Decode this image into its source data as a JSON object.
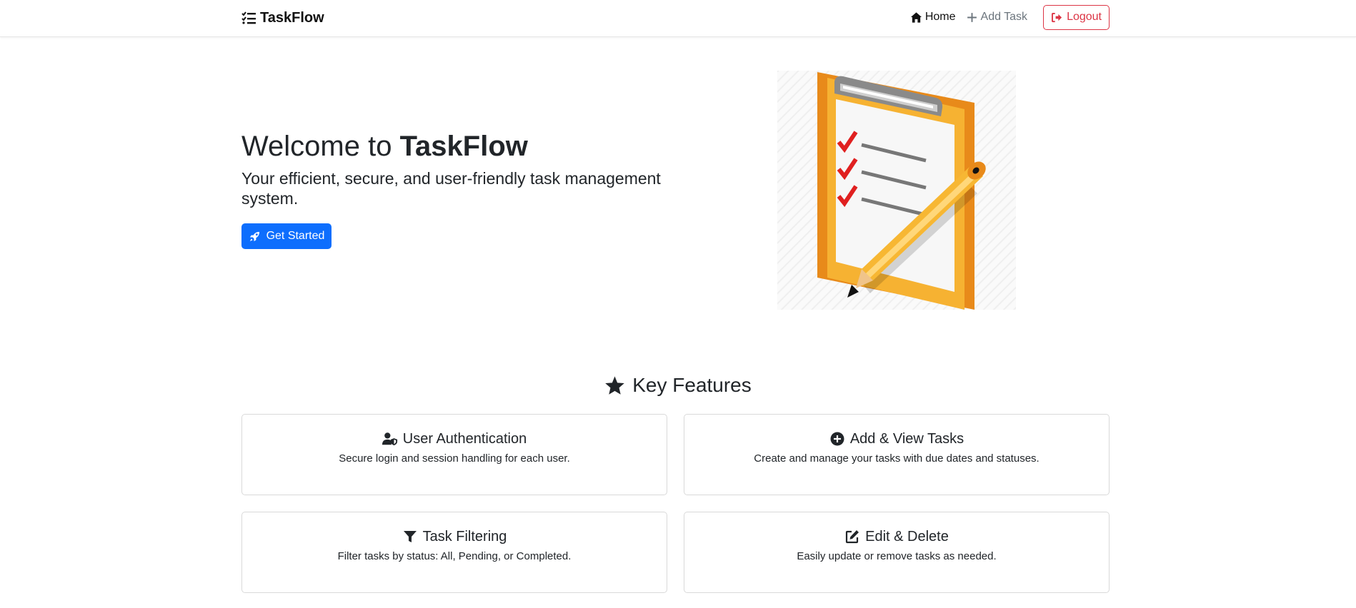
{
  "nav": {
    "brand": "TaskFlow",
    "links": {
      "home": "Home",
      "add_task": "Add Task",
      "logout": "Logout"
    }
  },
  "hero": {
    "title_prefix": "Welcome to ",
    "title_brand": "TaskFlow",
    "subtitle": "Your efficient, secure, and user-friendly task management system.",
    "cta": "Get Started"
  },
  "features": {
    "heading": "Key Features",
    "items": [
      {
        "icon": "user-shield-icon",
        "title": "User Authentication",
        "text": "Secure login and session handling for each user."
      },
      {
        "icon": "plus-circle-icon",
        "title": "Add & View Tasks",
        "text": "Create and manage your tasks with due dates and statuses."
      },
      {
        "icon": "filter-icon",
        "title": "Task Filtering",
        "text": "Filter tasks by status: All, Pending, or Completed."
      },
      {
        "icon": "edit-icon",
        "title": "Edit & Delete",
        "text": "Easily update or remove tasks as needed."
      }
    ]
  },
  "colors": {
    "primary": "#0d6efd",
    "danger": "#dc3545",
    "muted": "#6c757d",
    "clipboard_orange": "#f5a623",
    "check_red": "#e02020"
  }
}
